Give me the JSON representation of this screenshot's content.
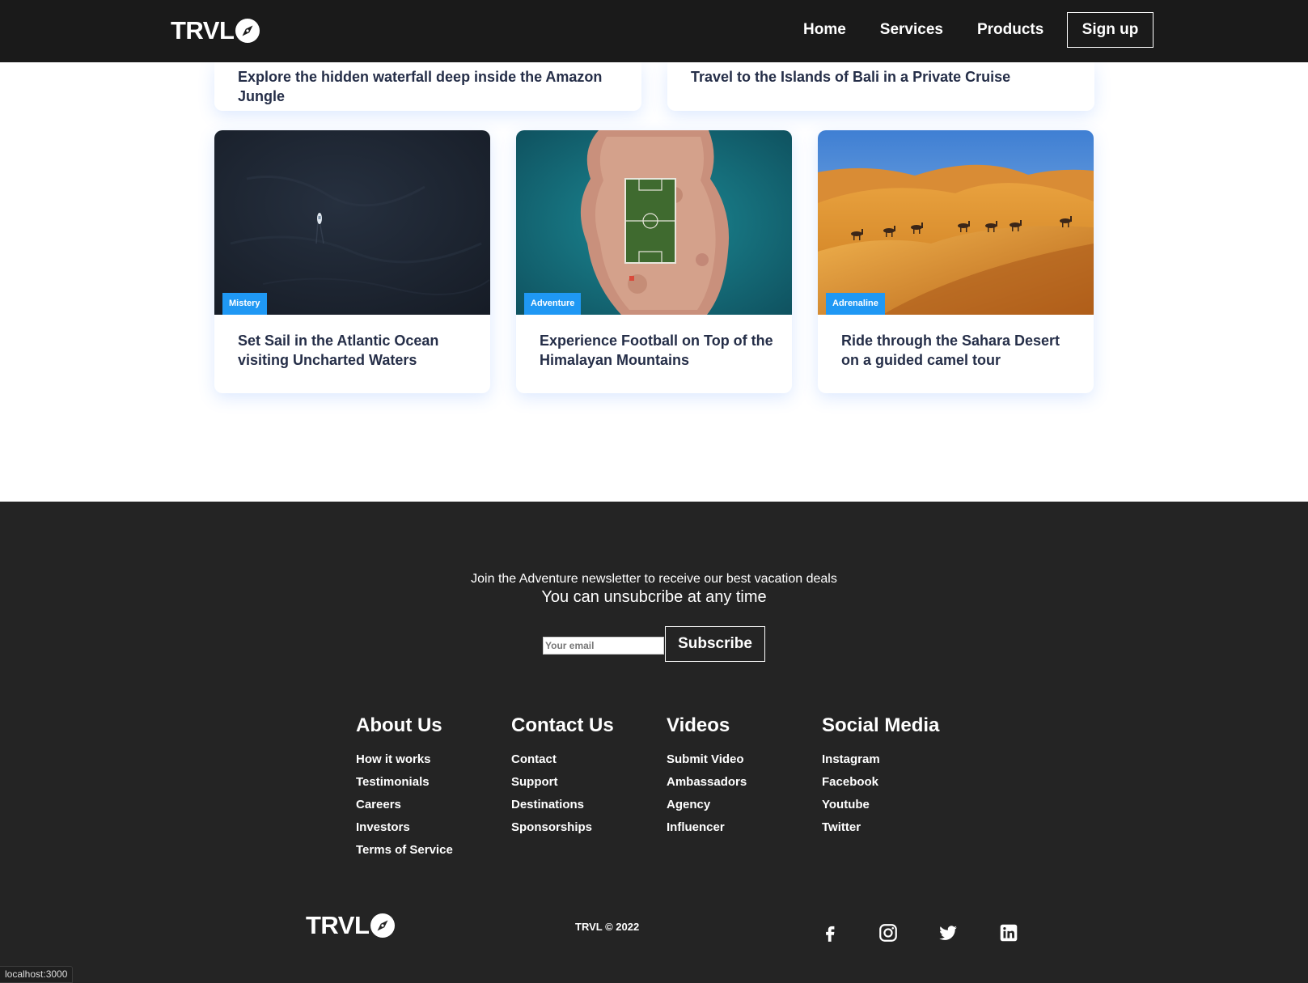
{
  "nav": {
    "brand": "TRVL",
    "links": [
      "Home",
      "Services",
      "Products"
    ],
    "signup": "Sign up"
  },
  "cards_top": [
    {
      "title": "Explore the hidden waterfall deep inside the Amazon Jungle"
    },
    {
      "title": "Travel to the Islands of Bali in a Private Cruise"
    }
  ],
  "cards": [
    {
      "label": "Mistery",
      "title": "Set Sail in the Atlantic Ocean visiting Uncharted Waters"
    },
    {
      "label": "Adventure",
      "title": "Experience Football on Top of the Himalayan Mountains"
    },
    {
      "label": "Adrenaline",
      "title": "Ride through the Sahara Desert on a guided camel tour"
    }
  ],
  "newsletter": {
    "heading": "Join the Adventure newsletter to receive our best vacation deals",
    "subheading": "You can unsubcribe at any time",
    "email_placeholder": "Your email",
    "subscribe": "Subscribe"
  },
  "footer_columns": [
    {
      "title": "About Us",
      "links": [
        "How it works",
        "Testimonials",
        "Careers",
        "Investors",
        "Terms of Service"
      ]
    },
    {
      "title": "Contact Us",
      "links": [
        "Contact",
        "Support",
        "Destinations",
        "Sponsorships"
      ]
    },
    {
      "title": "Videos",
      "links": [
        "Submit Video",
        "Ambassadors",
        "Agency",
        "Influencer"
      ]
    },
    {
      "title": "Social Media",
      "links": [
        "Instagram",
        "Facebook",
        "Youtube",
        "Twitter"
      ]
    }
  ],
  "footer": {
    "brand": "TRVL",
    "copyright": "TRVL © 2022",
    "social_icons": [
      "facebook-icon",
      "instagram-icon",
      "twitter-icon",
      "linkedin-icon"
    ]
  },
  "status_url": "localhost:3000",
  "colors": {
    "nav_bg": "#1a1a1a",
    "footer_bg": "#242424",
    "badge": "#1f98f4",
    "card_title": "#252e48"
  }
}
